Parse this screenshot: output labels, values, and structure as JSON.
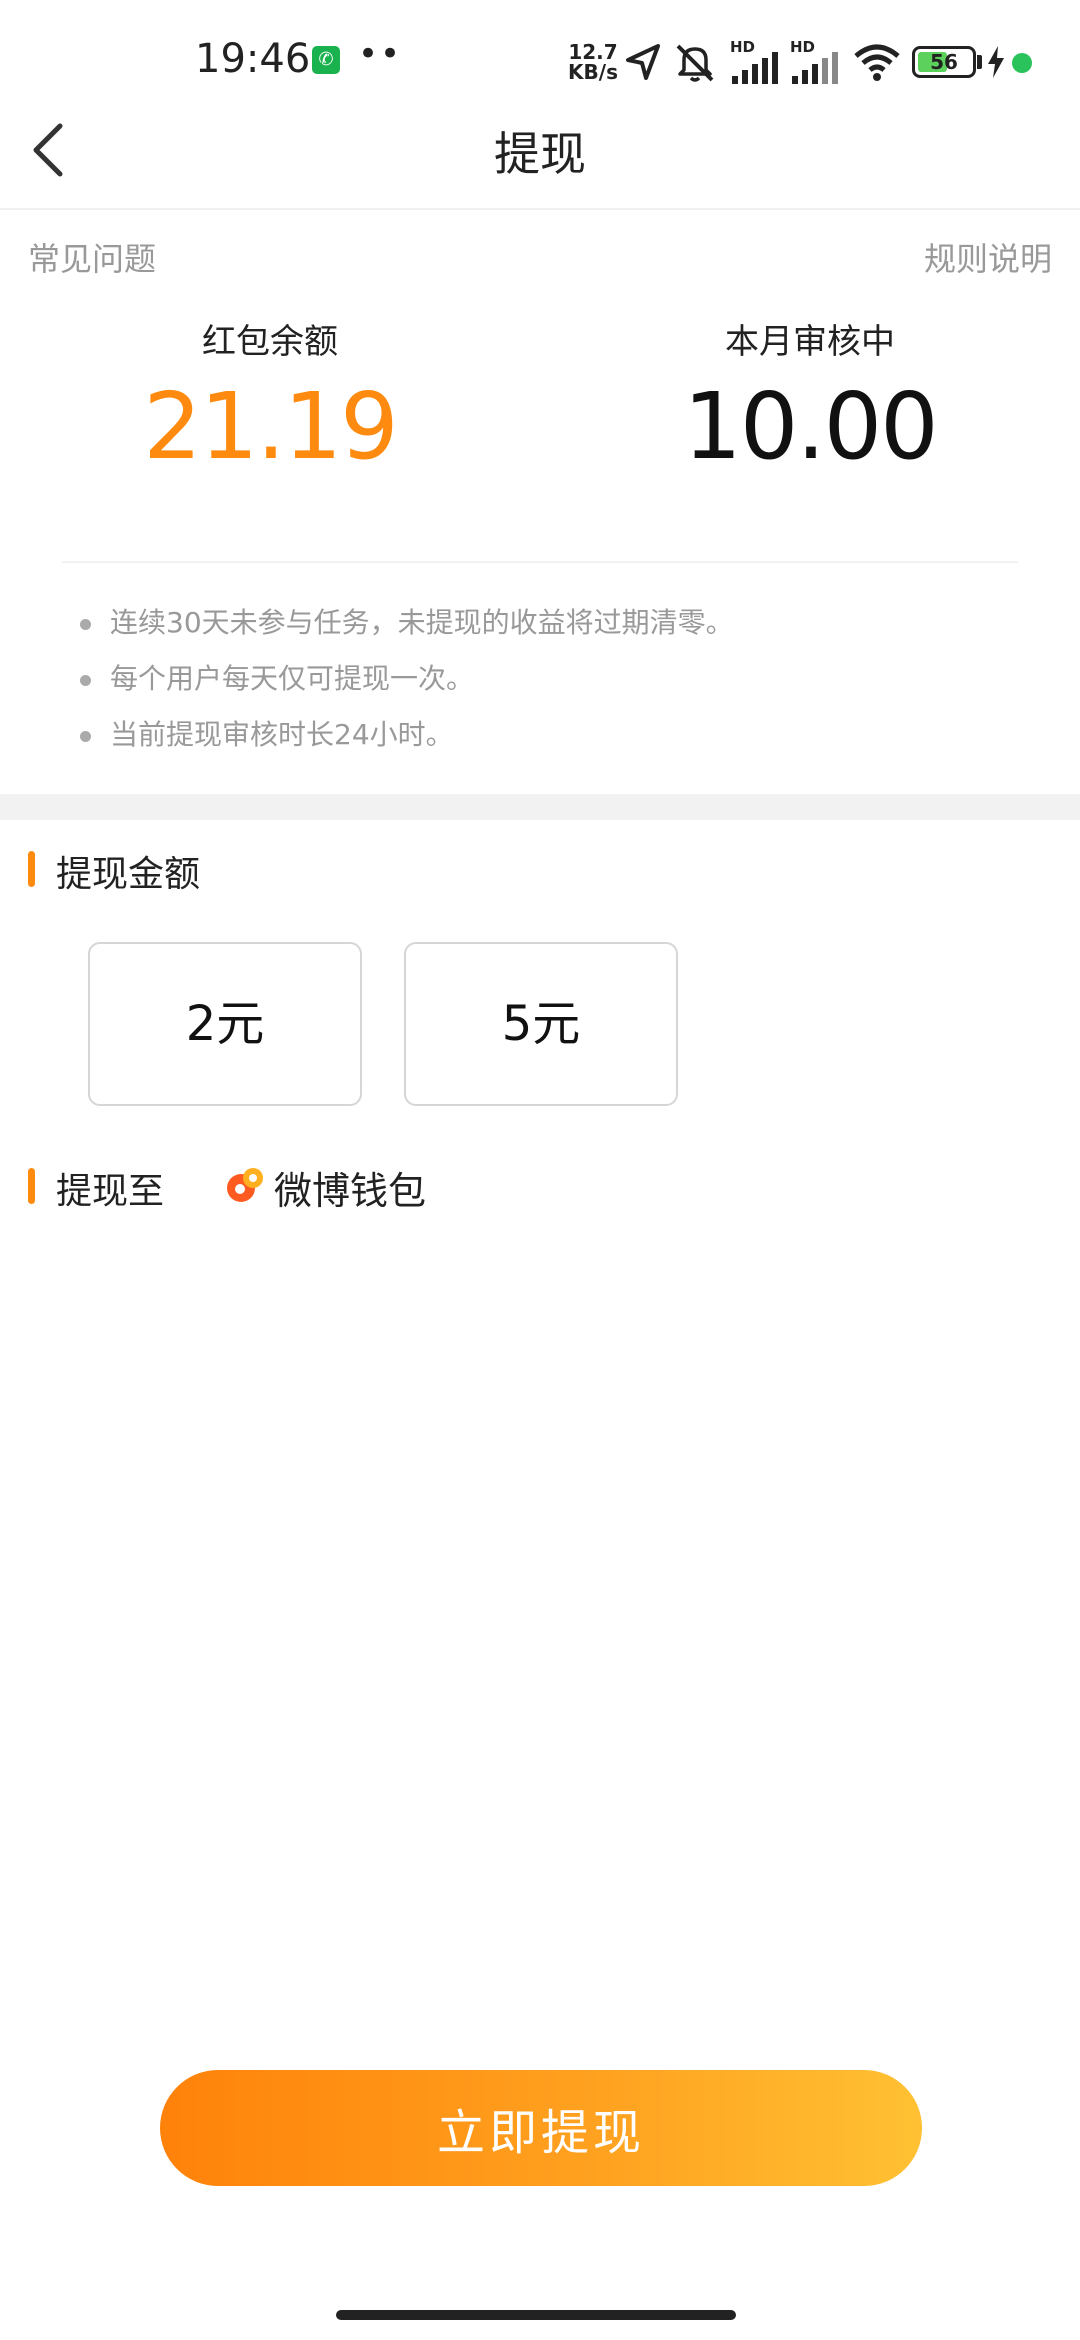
{
  "status_bar": {
    "time": "19:46",
    "call_icon": "phone-icon",
    "more": "••",
    "net_speed_value": "12.7",
    "net_speed_unit": "KB/s",
    "signal_label_1": "HD",
    "signal_label_2": "HD",
    "battery": "56",
    "battery_level": 0.56
  },
  "nav": {
    "title": "提现",
    "back_icon": "chevron-left-icon"
  },
  "links": {
    "faq": "常见问题",
    "rules": "规则说明"
  },
  "stats": {
    "balance_label": "红包余额",
    "balance_value": "21.19",
    "pending_label": "本月审核中",
    "pending_value": "10.00"
  },
  "notes": [
    "连续30天未参与任务，未提现的收益将过期清零。",
    "每个用户每天仅可提现一次。",
    "当前提现审核时长24小时。"
  ],
  "amount_section": {
    "title": "提现金额",
    "options": [
      "2元",
      "5元"
    ]
  },
  "destination": {
    "label": "提现至",
    "wallet": "微博钱包",
    "wallet_icon": "weibo-wallet-icon"
  },
  "cta": {
    "label": "立即提现"
  },
  "colors": {
    "accent": "#ff8a10",
    "gradient_start": "#ff820a",
    "gradient_end": "#ffc133"
  }
}
